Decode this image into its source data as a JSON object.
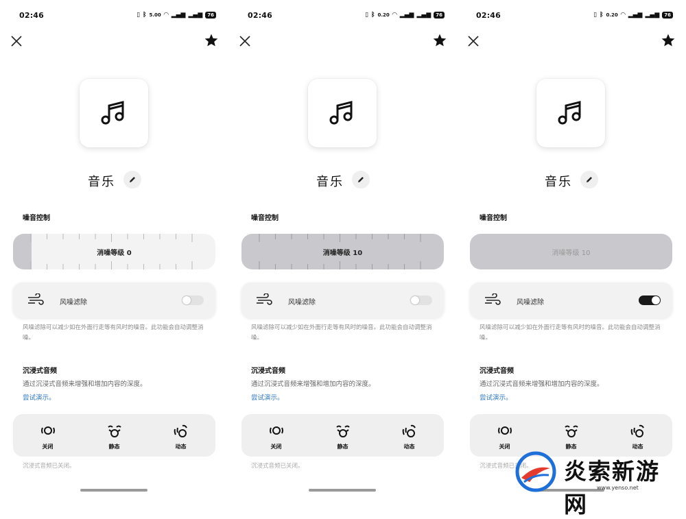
{
  "screens": [
    {
      "status": {
        "time": "02:46",
        "net_speed": "5.00",
        "net_unit": "KB/s",
        "battery": "76"
      },
      "title": "音乐",
      "noise_control": {
        "heading": "噪音控制",
        "label": "消噪等级 0",
        "level": 0
      },
      "wind": {
        "label": "风噪滤除",
        "enabled": false,
        "description": "风噪滤除可以减少如在外面行走等有风时的噪音。此功能会自动调整消噪。"
      },
      "immersive": {
        "heading": "沉浸式音频",
        "description": "通过沉浸式音频来增强和增加内容的深度。",
        "demo_link": "尝试演示。",
        "options": [
          "关闭",
          "静态",
          "动态"
        ],
        "selected": "关闭",
        "status_text": "沉浸式音频已关闭。"
      }
    },
    {
      "status": {
        "time": "02:46",
        "net_speed": "0.20",
        "net_unit": "KB/s",
        "battery": "76"
      },
      "title": "音乐",
      "noise_control": {
        "heading": "噪音控制",
        "label": "消噪等级 10",
        "level": 10
      },
      "wind": {
        "label": "风噪滤除",
        "enabled": false,
        "description": "风噪滤除可以减少如在外面行走等有风时的噪音。此功能会自动调整消噪。"
      },
      "immersive": {
        "heading": "沉浸式音频",
        "description": "通过沉浸式音频来增强和增加内容的深度。",
        "demo_link": "尝试演示。",
        "options": [
          "关闭",
          "静态",
          "动态"
        ],
        "selected": "关闭",
        "status_text": "沉浸式音频已关闭。"
      }
    },
    {
      "status": {
        "time": "02:46",
        "net_speed": "0.20",
        "net_unit": "KB/s",
        "battery": "76"
      },
      "title": "音乐",
      "noise_control": {
        "heading": "噪音控制",
        "label": "消噪等级 10",
        "level": 10
      },
      "wind": {
        "label": "风噪滤除",
        "enabled": true,
        "description": "风噪滤除可以减少如在外面行走等有风时的噪音。此功能会自动调整消噪。"
      },
      "immersive": {
        "heading": "沉浸式音频",
        "description": "通过沉浸式音频来增强和增加内容的深度。",
        "demo_link": "尝试演示。",
        "options": [
          "关闭",
          "静态",
          "动态"
        ],
        "selected": "关闭",
        "status_text": "沉浸式音频已关闭。"
      }
    }
  ],
  "icons": {
    "close": "close-icon",
    "star": "star-icon",
    "music": "music-note-icon",
    "edit": "pencil-icon",
    "wind": "wind-icon"
  },
  "colors": {
    "accent_link": "#2f78c2",
    "toggle_on": "#1a1a1a",
    "slider_fill": "#c9c9cd"
  },
  "watermark": {
    "text": "炎索新游网",
    "url": "www.yenso.net"
  }
}
